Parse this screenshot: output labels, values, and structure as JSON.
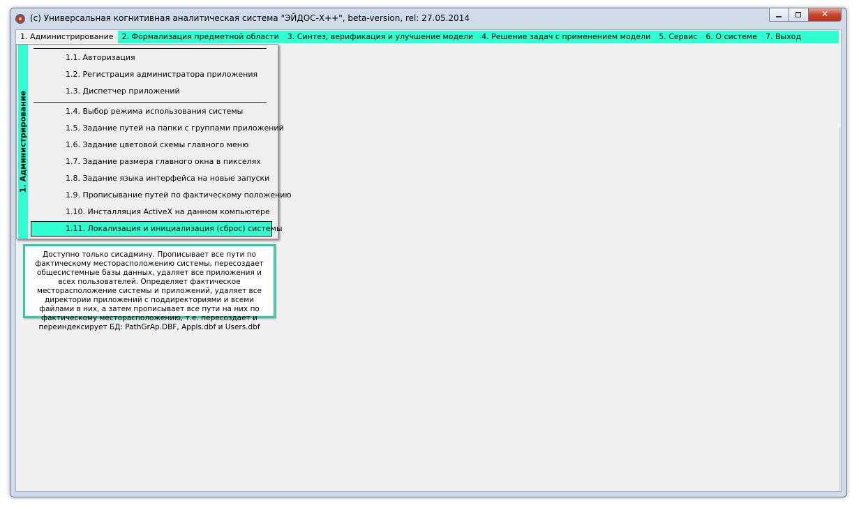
{
  "window": {
    "title": "(c) Универсальная когнитивная аналитическая система \"ЭЙДОС-Х++\", beta-version, rel: 27.05.2014",
    "close_glyph": "✕"
  },
  "menubar": {
    "items": [
      "1. Администрирование",
      "2. Формализация предметной области",
      "3. Синтез, верификация и улучшение модели",
      "4. Решение задач с применением модели",
      "5. Сервис",
      "6. О системе",
      "7. Выход"
    ]
  },
  "dropdown": {
    "strip_label": "1. Администрирование",
    "items": [
      "1.1. Авторизация",
      "1.2. Регистрация администратора приложения",
      "1.3. Диспетчер приложений",
      "1.4. Выбор режима использования системы",
      "1.5. Задание путей на папки с группами приложений",
      "1.6. Задание цветовой схемы главного меню",
      "1.7. Задание размера главного окна в пикселях",
      "1.8. Задание языка интерфейса на новые запуски",
      "1.9. Прописывание путей по фактическому положению",
      "1.10. Инсталляция ActiveX на данном компьютере",
      "1.11. Локализация и инициализация (сброс) системы"
    ]
  },
  "tooltip": {
    "text": "Доступно только сисадмину. Прописывает все пути по фактическому месторасположению системы, пересоздает общесистемные базы данных, удаляет все приложения и всех пользователей. Определяет фактическое месторасположение системы и приложений, удаляет все директории приложений с поддиректориями и всеми файлами в них, а затем прописывает все пути на них по фактическому месторасположению, т.е. пересоздает и переиндексирует БД: PathGrAp.DBF, Appls.dbf и Users.dbf"
  },
  "colors": {
    "menu_accent": "#2fffd1",
    "tooltip_border": "#2fc9a8"
  }
}
